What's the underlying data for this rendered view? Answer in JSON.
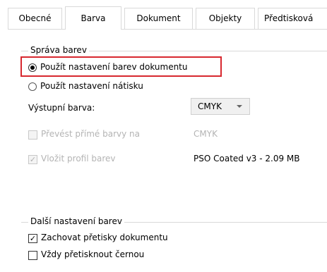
{
  "tabs": [
    {
      "label": "Obecné",
      "active": false
    },
    {
      "label": "Barva",
      "active": true
    },
    {
      "label": "Dokument",
      "active": false
    },
    {
      "label": "Objekty",
      "active": false
    },
    {
      "label": "Předtisková",
      "active": false
    }
  ],
  "color_management": {
    "legend": "Správa barev",
    "option_document": "Použít nastavení barev dokumentu",
    "option_proof": "Použít nastavení nátisku",
    "output_color_label": "Výstupní barva:",
    "output_color_value": "CMYK",
    "convert_spot_label": "Převést přímé barvy na",
    "convert_spot_value": "CMYK",
    "embed_profile_label": "Vložit profil barev",
    "embed_profile_value": "PSO Coated v3 - 2.09 MB"
  },
  "other_settings": {
    "legend": "Další nastavení barev",
    "keep_overprints": "Zachovat přetisky dokumentu",
    "always_overprint_black": "Vždy přetisknout černou"
  },
  "colors": {
    "highlight": "#d8282f",
    "border": "#d9d9d9",
    "disabled": "#b4b4b4"
  }
}
